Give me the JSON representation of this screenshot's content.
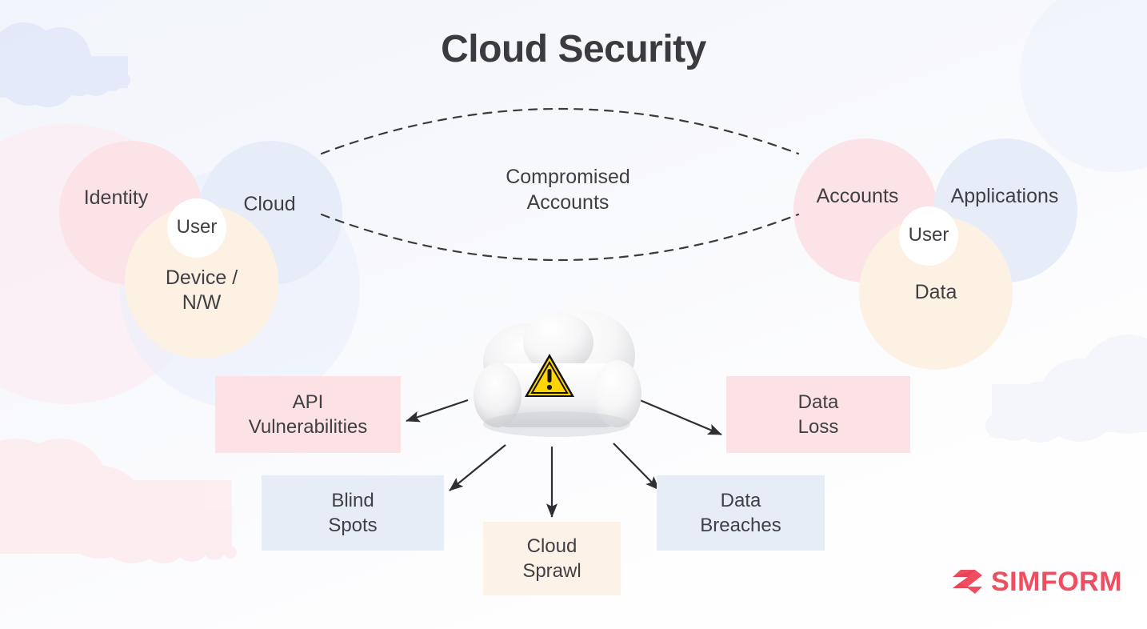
{
  "page": {
    "title": "Cloud Security",
    "background_color": "#f7f8fc"
  },
  "colors": {
    "pink": "#fbe3e7",
    "blue": "#e7edf8",
    "cream": "#fdf1e4",
    "white": "#ffffff",
    "box_pink": "#fce2e5",
    "box_blue": "#e6edf7",
    "box_cream": "#fdf2e8",
    "text": "#3f3f44",
    "title_text": "#3a3a3f",
    "arrow": "#2e2e33",
    "brand_red": "#ee4e5f",
    "warning_yellow": "#ffd400"
  },
  "venn_left": {
    "circles": [
      {
        "label": "Identity",
        "color": "#fbe3e7",
        "name": "identity"
      },
      {
        "label": "Cloud",
        "color": "#e7edf8",
        "name": "cloud"
      },
      {
        "label": "Device /\nN/W",
        "color": "#fdf1e4",
        "name": "device-nw"
      },
      {
        "label": "User",
        "color": "#ffffff",
        "name": "user"
      }
    ]
  },
  "venn_right": {
    "circles": [
      {
        "label": "Accounts",
        "color": "#fbe3e7",
        "name": "accounts"
      },
      {
        "label": "Applications",
        "color": "#e7edf8",
        "name": "applications"
      },
      {
        "label": "Data",
        "color": "#fdf1e4",
        "name": "data"
      },
      {
        "label": "User",
        "color": "#ffffff",
        "name": "user"
      }
    ]
  },
  "connector": {
    "label": "Compromised\nAccounts",
    "style": "dashed-lens"
  },
  "center_node": {
    "icon": "cloud-warning-icon",
    "description": "cloud with warning triangle"
  },
  "risk_boxes": [
    {
      "label": "API\nVulnerabilities",
      "color": "#fce2e5",
      "name": "api-vulnerabilities"
    },
    {
      "label": "Data\nLoss",
      "color": "#fce2e5",
      "name": "data-loss"
    },
    {
      "label": "Blind\nSpots",
      "color": "#e6edf7",
      "name": "blind-spots"
    },
    {
      "label": "Cloud\nSprawl",
      "color": "#fdf2e8",
      "name": "cloud-sprawl"
    },
    {
      "label": "Data\nBreaches",
      "color": "#e6edf7",
      "name": "data-breaches"
    }
  ],
  "logo": {
    "text": "SIMFORM",
    "color": "#ee4e5f",
    "mark": "simform-logo-mark"
  }
}
